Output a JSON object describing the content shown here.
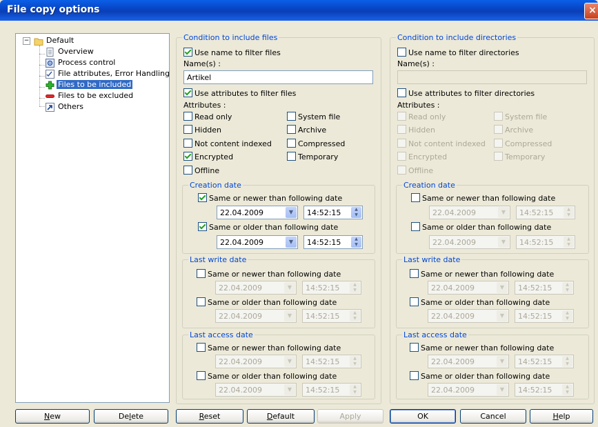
{
  "window": {
    "title": "File copy options",
    "close": "×"
  },
  "tree": {
    "root": "Default",
    "expander": "−",
    "items": [
      {
        "label": "Overview",
        "icon": "document-icon"
      },
      {
        "label": "Process control",
        "icon": "gear-document-icon"
      },
      {
        "label": "File attributes, Error Handling",
        "icon": "checklist-icon"
      },
      {
        "label": "Files to be included",
        "icon": "green-plus-icon",
        "selected": true
      },
      {
        "label": "Files to be excluded",
        "icon": "red-minus-icon"
      },
      {
        "label": "Others",
        "icon": "shortcut-arrow-icon"
      }
    ]
  },
  "files": {
    "group_label": "Condition to include files",
    "use_name": "Use name to filter files",
    "names_label": "Name(s) :",
    "names_value": "Artikel",
    "use_attr": "Use attributes to filter files",
    "attributes_label": "Attributes :",
    "attr": {
      "read_only": "Read only",
      "system_file": "System file",
      "hidden": "Hidden",
      "archive": "Archive",
      "not_indexed": "Not content indexed",
      "compressed": "Compressed",
      "encrypted": "Encrypted",
      "temporary": "Temporary",
      "offline": "Offline"
    },
    "creation": {
      "label": "Creation date",
      "newer": {
        "label": "Same or newer than following date",
        "date": "22.04.2009",
        "time": "14:52:15"
      },
      "older": {
        "label": "Same or older than following date",
        "date": "22.04.2009",
        "time": "14:52:15"
      }
    },
    "lastwrite": {
      "label": "Last write date",
      "newer": {
        "label": "Same or newer than following date",
        "date": "22.04.2009",
        "time": "14:52:15"
      },
      "older": {
        "label": "Same or older than following date",
        "date": "22.04.2009",
        "time": "14:52:15"
      }
    },
    "lastaccess": {
      "label": "Last access date",
      "newer": {
        "label": "Same or newer than following date",
        "date": "22.04.2009",
        "time": "14:52:15"
      },
      "older": {
        "label": "Same or older than following date",
        "date": "22.04.2009",
        "time": "14:52:15"
      }
    }
  },
  "dirs": {
    "group_label": "Condition to include directories",
    "use_name": "Use name to filter directories",
    "names_label": "Name(s) :",
    "names_value": "",
    "use_attr": "Use attributes to filter directories",
    "attributes_label": "Attributes :",
    "attr": {
      "read_only": "Read only",
      "system_file": "System file",
      "hidden": "Hidden",
      "archive": "Archive",
      "not_indexed": "Not content indexed",
      "compressed": "Compressed",
      "encrypted": "Encrypted",
      "temporary": "Temporary",
      "offline": "Offline"
    },
    "creation": {
      "label": "Creation date",
      "newer": {
        "label": "Same or newer than following date",
        "date": "22.04.2009",
        "time": "14:52:15"
      },
      "older": {
        "label": "Same or older than following date",
        "date": "22.04.2009",
        "time": "14:52:15"
      }
    },
    "lastwrite": {
      "label": "Last write date",
      "newer": {
        "label": "Same or newer than following date",
        "date": "22.04.2009",
        "time": "14:52:15"
      },
      "older": {
        "label": "Same or older than following date",
        "date": "22.04.2009",
        "time": "14:52:15"
      }
    },
    "lastaccess": {
      "label": "Last access date",
      "newer": {
        "label": "Same or newer than following date",
        "date": "22.04.2009",
        "time": "14:52:15"
      },
      "older": {
        "label": "Same or older than following date",
        "date": "22.04.2009",
        "time": "14:52:15"
      }
    }
  },
  "buttons": {
    "new": {
      "first": "N",
      "rest": "ew"
    },
    "delete": {
      "first": "De",
      "u": "l",
      "rest": "ete"
    },
    "reset": {
      "first": "R",
      "rest": "eset"
    },
    "default": {
      "first": "D",
      "rest": "efault"
    },
    "apply": "Apply",
    "ok": "OK",
    "cancel": "Cancel",
    "help": {
      "first": "H",
      "rest": "elp"
    }
  },
  "colors": {
    "titlebar": "#0843c4",
    "group_label": "#0046d5",
    "selection": "#316ac5",
    "check": "#21a121"
  }
}
